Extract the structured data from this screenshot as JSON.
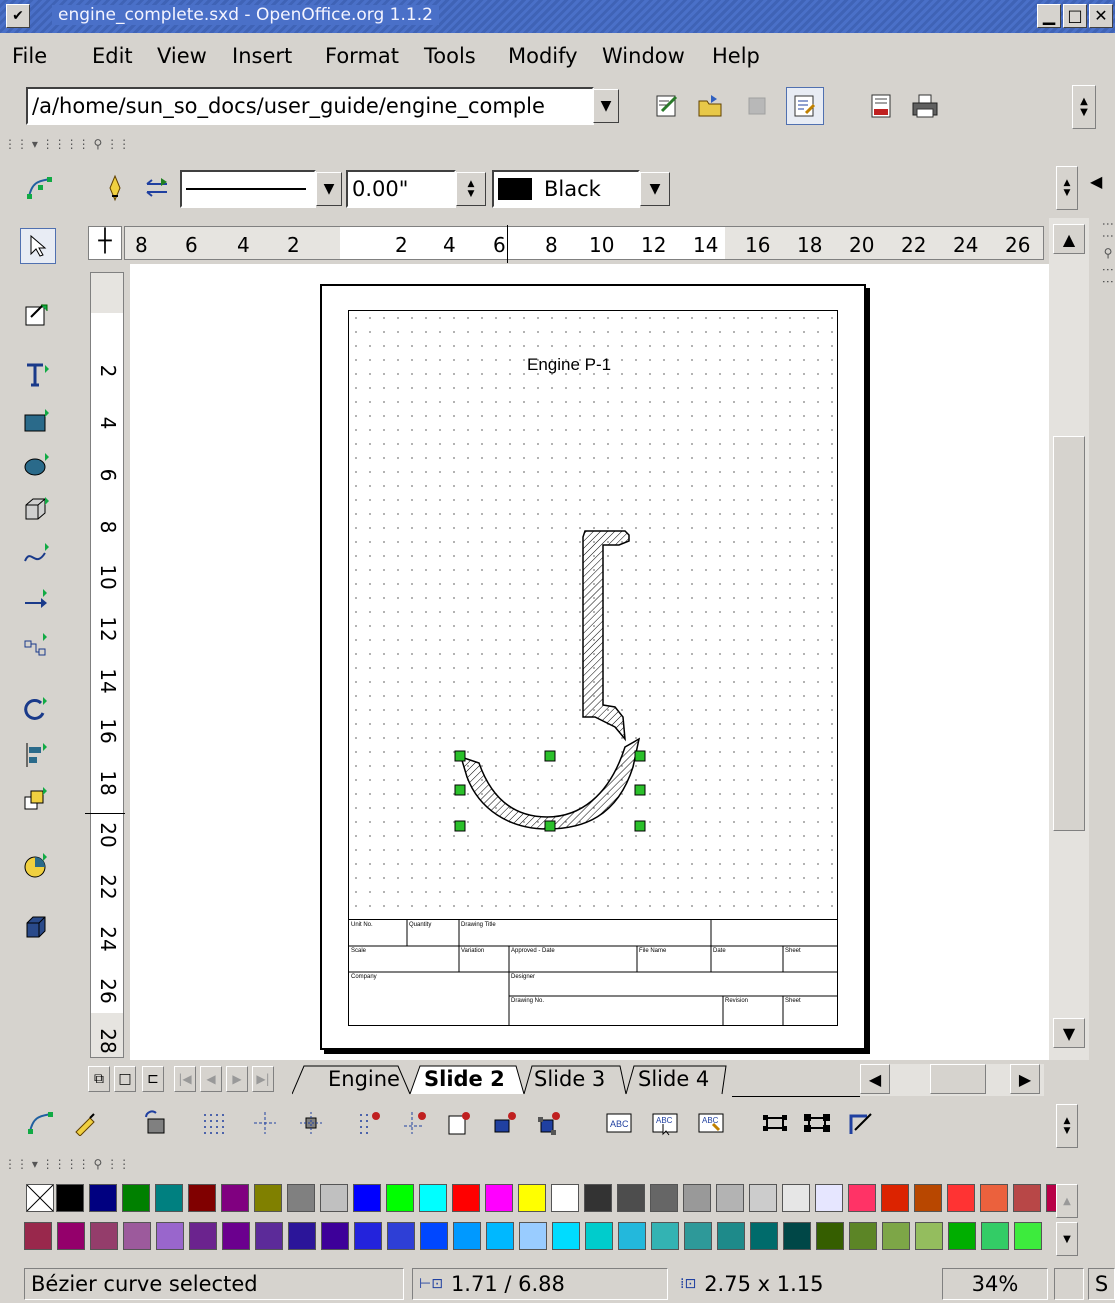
{
  "window": {
    "title": "engine_complete.sxd - OpenOffice.org 1.1.2",
    "controls": [
      "_",
      "□",
      "×"
    ]
  },
  "menubar": {
    "items": [
      "File",
      "Edit",
      "View",
      "Insert",
      "Format",
      "Tools",
      "Modify",
      "Window",
      "Help"
    ]
  },
  "function_bar": {
    "url": "/a/home/sun_so_docs/user_guide/engine_comple",
    "icons": [
      "edit-file-icon",
      "open-folder-icon",
      "disabled-icon",
      "edit-mode-icon",
      "export-pdf-icon",
      "print-icon"
    ]
  },
  "object_bar": {
    "line_style_value": "",
    "line_width": "0.00\"",
    "line_color": "Black",
    "line_color_hex": "#000000"
  },
  "hruler": {
    "labels_left": [
      "8",
      "6",
      "4",
      "2"
    ],
    "labels_right": [
      "2",
      "4",
      "6",
      "8",
      "10",
      "12",
      "14",
      "16",
      "18",
      "20",
      "22",
      "24",
      "26"
    ]
  },
  "vruler": {
    "labels": [
      "2",
      "4",
      "6",
      "8",
      "10",
      "12",
      "14",
      "16",
      "18",
      "20",
      "22",
      "24",
      "26",
      "28"
    ]
  },
  "drawing": {
    "title": "Engine P-1",
    "titleblock": {
      "row1": [
        "Unit No.",
        "Quantity",
        "Drawing Title"
      ],
      "row2": [
        "Scale",
        "Variation",
        "Approved - Date",
        "File Name",
        "Date",
        "Sheet"
      ],
      "row3": [
        "Company",
        "Designer"
      ],
      "row4": [
        "Drawing No.",
        "Revision",
        "Sheet"
      ]
    }
  },
  "tabs": {
    "items": [
      "Engine",
      "Slide 2",
      "Slide 3",
      "Slide 4"
    ],
    "active": "Slide 2"
  },
  "palette": {
    "row1": [
      "#000000",
      "#000080",
      "#008000",
      "#008080",
      "#800000",
      "#800080",
      "#808000",
      "#808080",
      "#c0c0c0",
      "#0000ff",
      "#00ff00",
      "#00ffff",
      "#ff0000",
      "#ff00ff",
      "#ffff00",
      "#ffffff",
      "#333333",
      "#4d4d4d",
      "#666666",
      "#999999",
      "#b3b3b3",
      "#cccccc",
      "#e6e6e6",
      "#e6e6ff",
      "#ff3366",
      "#dc2300",
      "#b84700",
      "#ff3333",
      "#eb613d",
      "#b84747",
      "#b80047"
    ],
    "row2": [
      "#99284c",
      "#94006b",
      "#943d6b",
      "#9c5a9c",
      "#9966cc",
      "#6b238e",
      "#6b008e",
      "#5c2b99",
      "#2b1599",
      "#3d0099",
      "#2323dc",
      "#2e3fd6",
      "#0047ff",
      "#0099ff",
      "#00b8ff",
      "#99ccff",
      "#00dcff",
      "#00cccc",
      "#23b8dc",
      "#33b3b3",
      "#2e9999",
      "#1e8a8a",
      "#006b6b",
      "#004747",
      "#355e00",
      "#5c8526",
      "#7da647",
      "#94bd5e",
      "#00ae00",
      "#33cc66",
      "#3deb3d"
    ]
  },
  "statusbar": {
    "message": "Bézier curve selected",
    "position": "1.71 / 6.88",
    "size": "2.75 x 1.15",
    "zoom": "34%",
    "mode": "S"
  }
}
